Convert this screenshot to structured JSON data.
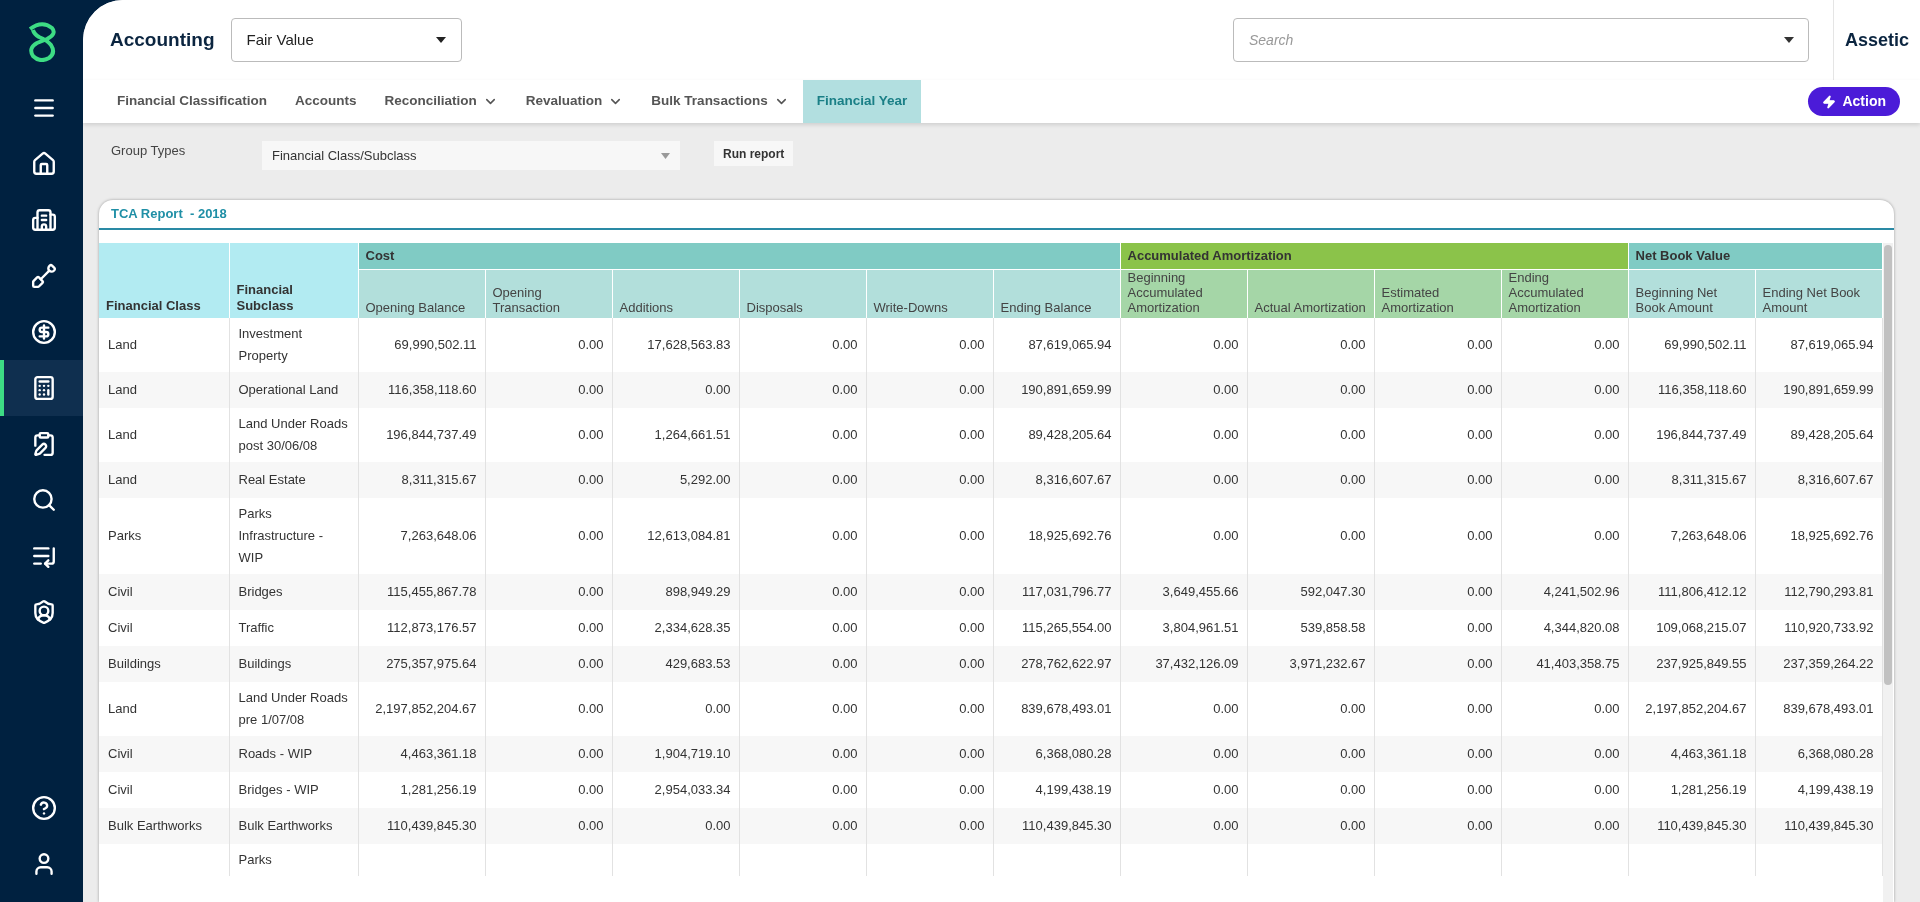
{
  "sidebar": {
    "items": [
      {
        "selected": false
      },
      {
        "selected": false
      },
      {
        "selected": false
      },
      {
        "selected": false
      },
      {
        "selected": false
      },
      {
        "selected": true
      },
      {
        "selected": false
      },
      {
        "selected": false
      },
      {
        "selected": false
      },
      {
        "selected": false
      }
    ],
    "footer": [
      {
        "selected": false
      },
      {
        "selected": false
      }
    ]
  },
  "header": {
    "title": "Accounting",
    "view_select": {
      "value": "Fair Value"
    },
    "search": {
      "placeholder": "Search"
    },
    "org": "Assetic"
  },
  "tabs": [
    {
      "label": "Financial Classification",
      "has_menu": false,
      "selected": false
    },
    {
      "label": "Accounts",
      "has_menu": false,
      "selected": false
    },
    {
      "label": "Reconciliation",
      "has_menu": true,
      "selected": false
    },
    {
      "label": "Revaluation",
      "has_menu": true,
      "selected": false
    },
    {
      "label": "Bulk Transactions",
      "has_menu": true,
      "selected": false
    },
    {
      "label": "Financial Year",
      "has_menu": false,
      "selected": true
    }
  ],
  "action_button": "Action",
  "filter": {
    "label": "Group Types",
    "value": "Financial Class/Subclass",
    "button": "Run report"
  },
  "report": {
    "title": "TCA Report  - 2018",
    "key_columns": [
      {
        "label": "Financial Class",
        "color": "#b2ebf2"
      },
      {
        "label": "Financial Subclass",
        "color": "#b2ebf2"
      }
    ],
    "column_groups": [
      {
        "label": "Cost",
        "color": "#80cbc4",
        "columns": [
          {
            "label": "Opening Balance",
            "color": "#b2dfdb"
          },
          {
            "label": "Opening Transaction",
            "color": "#b2dfdb"
          },
          {
            "label": "Additions",
            "color": "#b2dfdb"
          },
          {
            "label": "Disposals",
            "color": "#b2dfdb"
          },
          {
            "label": "Write-Downs",
            "color": "#b2dfdb"
          },
          {
            "label": "Ending Balance",
            "color": "#b2dfdb"
          }
        ]
      },
      {
        "label": "Accumulated Amortization",
        "color": "#8bc34a",
        "columns": [
          {
            "label": "Beginning Accumulated Amortization",
            "color": "#a5d6a7"
          },
          {
            "label": "Actual Amortization",
            "color": "#a5d6a7"
          },
          {
            "label": "Estimated Amortization",
            "color": "#a5d6a7"
          },
          {
            "label": "Ending Accumulated Amortization",
            "color": "#a5d6a7"
          }
        ]
      },
      {
        "label": "Net Book Value",
        "color": "#80cbc4",
        "columns": [
          {
            "label": "Beginning Net Book Amount",
            "color": "#b2dfdb"
          },
          {
            "label": "Ending Net Book Amount",
            "color": "#b2dfdb"
          }
        ]
      }
    ],
    "rows": [
      {
        "financial_class": "Land",
        "financial_subclass": "Investment Property",
        "values": [
          "69,990,502.11",
          "0.00",
          "17,628,563.83",
          "0.00",
          "0.00",
          "87,619,065.94",
          "0.00",
          "0.00",
          "0.00",
          "0.00",
          "69,990,502.11",
          "87,619,065.94"
        ]
      },
      {
        "financial_class": "Land",
        "financial_subclass": "Operational Land",
        "values": [
          "116,358,118.60",
          "0.00",
          "0.00",
          "0.00",
          "0.00",
          "190,891,659.99",
          "0.00",
          "0.00",
          "0.00",
          "0.00",
          "116,358,118.60",
          "190,891,659.99"
        ]
      },
      {
        "financial_class": "Land",
        "financial_subclass": "Land Under Roads post 30/06/08",
        "values": [
          "196,844,737.49",
          "0.00",
          "1,264,661.51",
          "0.00",
          "0.00",
          "89,428,205.64",
          "0.00",
          "0.00",
          "0.00",
          "0.00",
          "196,844,737.49",
          "89,428,205.64"
        ]
      },
      {
        "financial_class": "Land",
        "financial_subclass": "Real Estate",
        "values": [
          "8,311,315.67",
          "0.00",
          "5,292.00",
          "0.00",
          "0.00",
          "8,316,607.67",
          "0.00",
          "0.00",
          "0.00",
          "0.00",
          "8,311,315.67",
          "8,316,607.67"
        ]
      },
      {
        "financial_class": "Parks",
        "financial_subclass": "Parks Infrastructure - WIP",
        "values": [
          "7,263,648.06",
          "0.00",
          "12,613,084.81",
          "0.00",
          "0.00",
          "18,925,692.76",
          "0.00",
          "0.00",
          "0.00",
          "0.00",
          "7,263,648.06",
          "18,925,692.76"
        ]
      },
      {
        "financial_class": "Civil",
        "financial_subclass": "Bridges",
        "values": [
          "115,455,867.78",
          "0.00",
          "898,949.29",
          "0.00",
          "0.00",
          "117,031,796.77",
          "3,649,455.66",
          "592,047.30",
          "0.00",
          "4,241,502.96",
          "111,806,412.12",
          "112,790,293.81"
        ]
      },
      {
        "financial_class": "Civil",
        "financial_subclass": "Traffic",
        "values": [
          "112,873,176.57",
          "0.00",
          "2,334,628.35",
          "0.00",
          "0.00",
          "115,265,554.00",
          "3,804,961.51",
          "539,858.58",
          "0.00",
          "4,344,820.08",
          "109,068,215.07",
          "110,920,733.92"
        ]
      },
      {
        "financial_class": "Buildings",
        "financial_subclass": "Buildings",
        "values": [
          "275,357,975.64",
          "0.00",
          "429,683.53",
          "0.00",
          "0.00",
          "278,762,622.97",
          "37,432,126.09",
          "3,971,232.67",
          "0.00",
          "41,403,358.75",
          "237,925,849.55",
          "237,359,264.22"
        ]
      },
      {
        "financial_class": "Land",
        "financial_subclass": "Land Under Roads pre 1/07/08",
        "values": [
          "2,197,852,204.67",
          "0.00",
          "0.00",
          "0.00",
          "0.00",
          "839,678,493.01",
          "0.00",
          "0.00",
          "0.00",
          "0.00",
          "2,197,852,204.67",
          "839,678,493.01"
        ]
      },
      {
        "financial_class": "Civil",
        "financial_subclass": "Roads - WIP",
        "values": [
          "4,463,361.18",
          "0.00",
          "1,904,719.10",
          "0.00",
          "0.00",
          "6,368,080.28",
          "0.00",
          "0.00",
          "0.00",
          "0.00",
          "4,463,361.18",
          "6,368,080.28"
        ]
      },
      {
        "financial_class": "Civil",
        "financial_subclass": "Bridges - WIP",
        "values": [
          "1,281,256.19",
          "0.00",
          "2,954,033.34",
          "0.00",
          "0.00",
          "4,199,438.19",
          "0.00",
          "0.00",
          "0.00",
          "0.00",
          "1,281,256.19",
          "4,199,438.19"
        ]
      },
      {
        "financial_class": "Bulk Earthworks",
        "financial_subclass": "Bulk Earthworks",
        "values": [
          "110,439,845.30",
          "0.00",
          "0.00",
          "0.00",
          "0.00",
          "110,439,845.30",
          "0.00",
          "0.00",
          "0.00",
          "0.00",
          "110,439,845.30",
          "110,439,845.30"
        ]
      },
      {
        "financial_subclass": "Parks"
      }
    ]
  }
}
